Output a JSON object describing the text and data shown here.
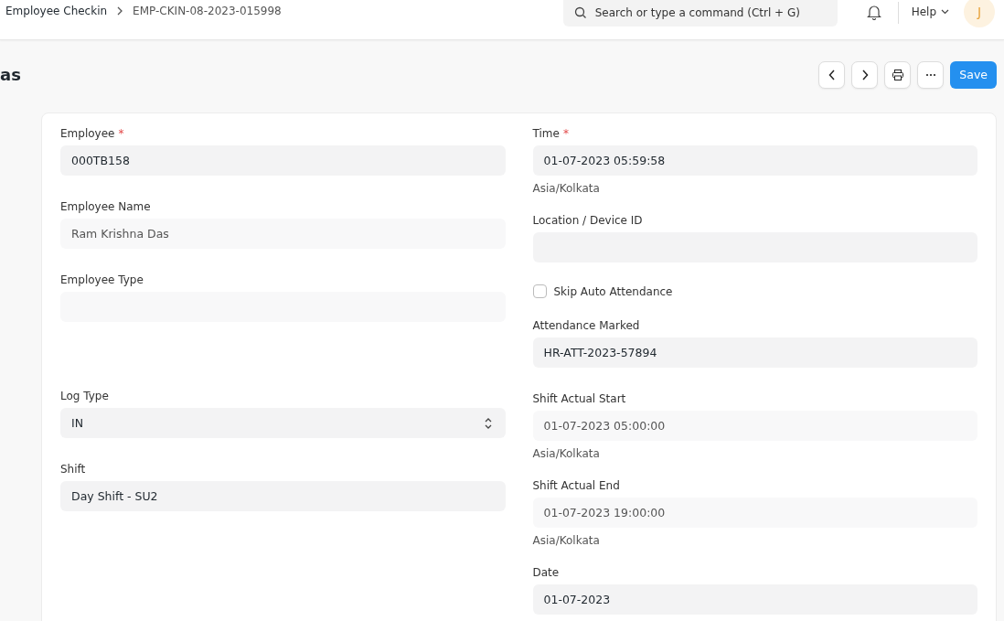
{
  "breadcrumbs": [
    {
      "label": "Employee Checkin"
    },
    {
      "label": "EMP-CKIN-08-2023-015998"
    }
  ],
  "search": {
    "placeholder": "Search or type a command (Ctrl + G)"
  },
  "help": {
    "label": "Help"
  },
  "avatar": {
    "initial": "J"
  },
  "page_title": "as",
  "save_button": "Save",
  "left_fields": [
    {
      "kind": "input",
      "label": "Employee",
      "required_mark": "*",
      "value": "000TB158"
    },
    {
      "kind": "readonly",
      "label": "Employee Name",
      "value": "Ram Krishna Das"
    },
    {
      "kind": "readonly",
      "label": "Employee Type"
    },
    {
      "kind": "select",
      "label": "Log Type",
      "value": "IN"
    },
    {
      "kind": "input",
      "label": "Shift",
      "value": "Day Shift - SU2"
    }
  ],
  "right_fields": [
    {
      "kind": "input",
      "label": "Time",
      "required_mark": "*",
      "value": "01-07-2023 05:59:58",
      "note": "Asia/Kolkata"
    },
    {
      "kind": "input",
      "label": "Location / Device ID"
    },
    {
      "kind": "checkbox",
      "label": "Skip Auto Attendance",
      "checked": false
    },
    {
      "kind": "input",
      "label": "Attendance Marked",
      "value": "HR-ATT-2023-57894"
    },
    {
      "kind": "readonly",
      "label": "Shift Actual Start",
      "value": "01-07-2023 05:00:00",
      "note": "Asia/Kolkata"
    },
    {
      "kind": "readonly",
      "label": "Shift Actual End",
      "value": "01-07-2023 19:00:00",
      "note": "Asia/Kolkata"
    },
    {
      "kind": "input",
      "label": "Date",
      "value": "01-07-2023"
    }
  ]
}
